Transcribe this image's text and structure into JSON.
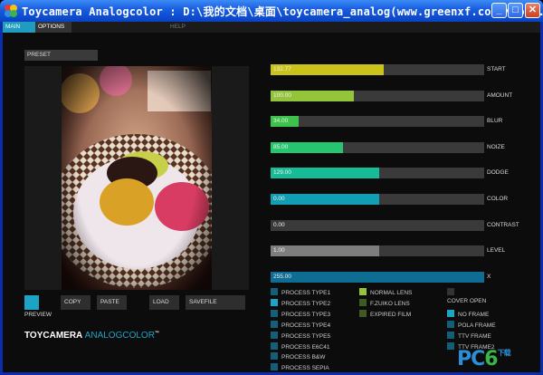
{
  "window": {
    "title": "Toycamera Analogcolor : D:\\我的文档\\桌面\\toycamera_analog(www.greenxf.com)\\toy...",
    "min_glyph": "_",
    "max_glyph": "□",
    "close_glyph": "✕"
  },
  "tabs": {
    "main": "MAIN",
    "options": "OPTIONS",
    "help": "HELP"
  },
  "preset": {
    "label": "PRESET"
  },
  "buttons": {
    "copy": "COPY",
    "paste": "PASTE",
    "load": "LOAD",
    "savefile": "SAVEFILE",
    "preview": "PREVIEW"
  },
  "logo": {
    "part1": "TOYCAMERA ",
    "part2": "ANALOGCOLOR",
    "tm": "™"
  },
  "sliders": [
    {
      "label": "START",
      "value": "132.77",
      "fraction": 0.53,
      "color": "#c9c31a"
    },
    {
      "label": "AMOUNT",
      "value": "100.00",
      "fraction": 0.39,
      "color": "#93c43a"
    },
    {
      "label": "BLUR",
      "value": "34.00",
      "fraction": 0.13,
      "color": "#3ec24b"
    },
    {
      "label": "NOIZE",
      "value": "85.00",
      "fraction": 0.34,
      "color": "#25c66f"
    },
    {
      "label": "DODGE",
      "value": "129.00",
      "fraction": 0.51,
      "color": "#17bb97"
    },
    {
      "label": "COLOR",
      "value": "0.00",
      "fraction": 0.51,
      "color": "#139fb3"
    },
    {
      "label": "CONTRAST",
      "value": "0.00",
      "fraction": 0.0,
      "color": "#3a3a3a"
    },
    {
      "label": "LEVEL",
      "value": "1.00",
      "fraction": 0.51,
      "color": "#7d7d7d"
    },
    {
      "label": "X",
      "value": "255.00",
      "fraction": 1.0,
      "color": "#0f6c93"
    }
  ],
  "process_types": [
    {
      "label": "PROCESS TYPE1",
      "color": "#155e7a"
    },
    {
      "label": "PROCESS TYPE2",
      "color": "#1fa3c4"
    },
    {
      "label": "PROCESS TYPE3",
      "color": "#155e7a"
    },
    {
      "label": "PROCESS TYPE4",
      "color": "#155e7a"
    },
    {
      "label": "PROCESS TYPE5",
      "color": "#155e7a"
    },
    {
      "label": "PROCESS E6C41",
      "color": "#155e7a"
    },
    {
      "label": "PROCESS B&W",
      "color": "#155e7a"
    },
    {
      "label": "PROCESS SEPIA",
      "color": "#155e7a"
    }
  ],
  "lens_options": [
    {
      "label": "NORMAL LENS",
      "color": "#93c43a"
    },
    {
      "label": "F.ZUIKO LENS",
      "color": "#3f5a22"
    },
    {
      "label": "EXPIRED FILM",
      "color": "#3f5a22"
    }
  ],
  "cover": {
    "label": "COVER OPEN"
  },
  "frames": [
    {
      "label": "NO FRAME",
      "color": "#1fa3c4"
    },
    {
      "label": "POLA FRAME",
      "color": "#155e7a"
    },
    {
      "label": "TTV FRAME",
      "color": "#155e7a"
    },
    {
      "label": "TTV FRAME2",
      "color": "#155e7a"
    }
  ],
  "watermark": {
    "p": "P",
    "c": "C",
    "six": "6",
    "sub": "下载"
  }
}
